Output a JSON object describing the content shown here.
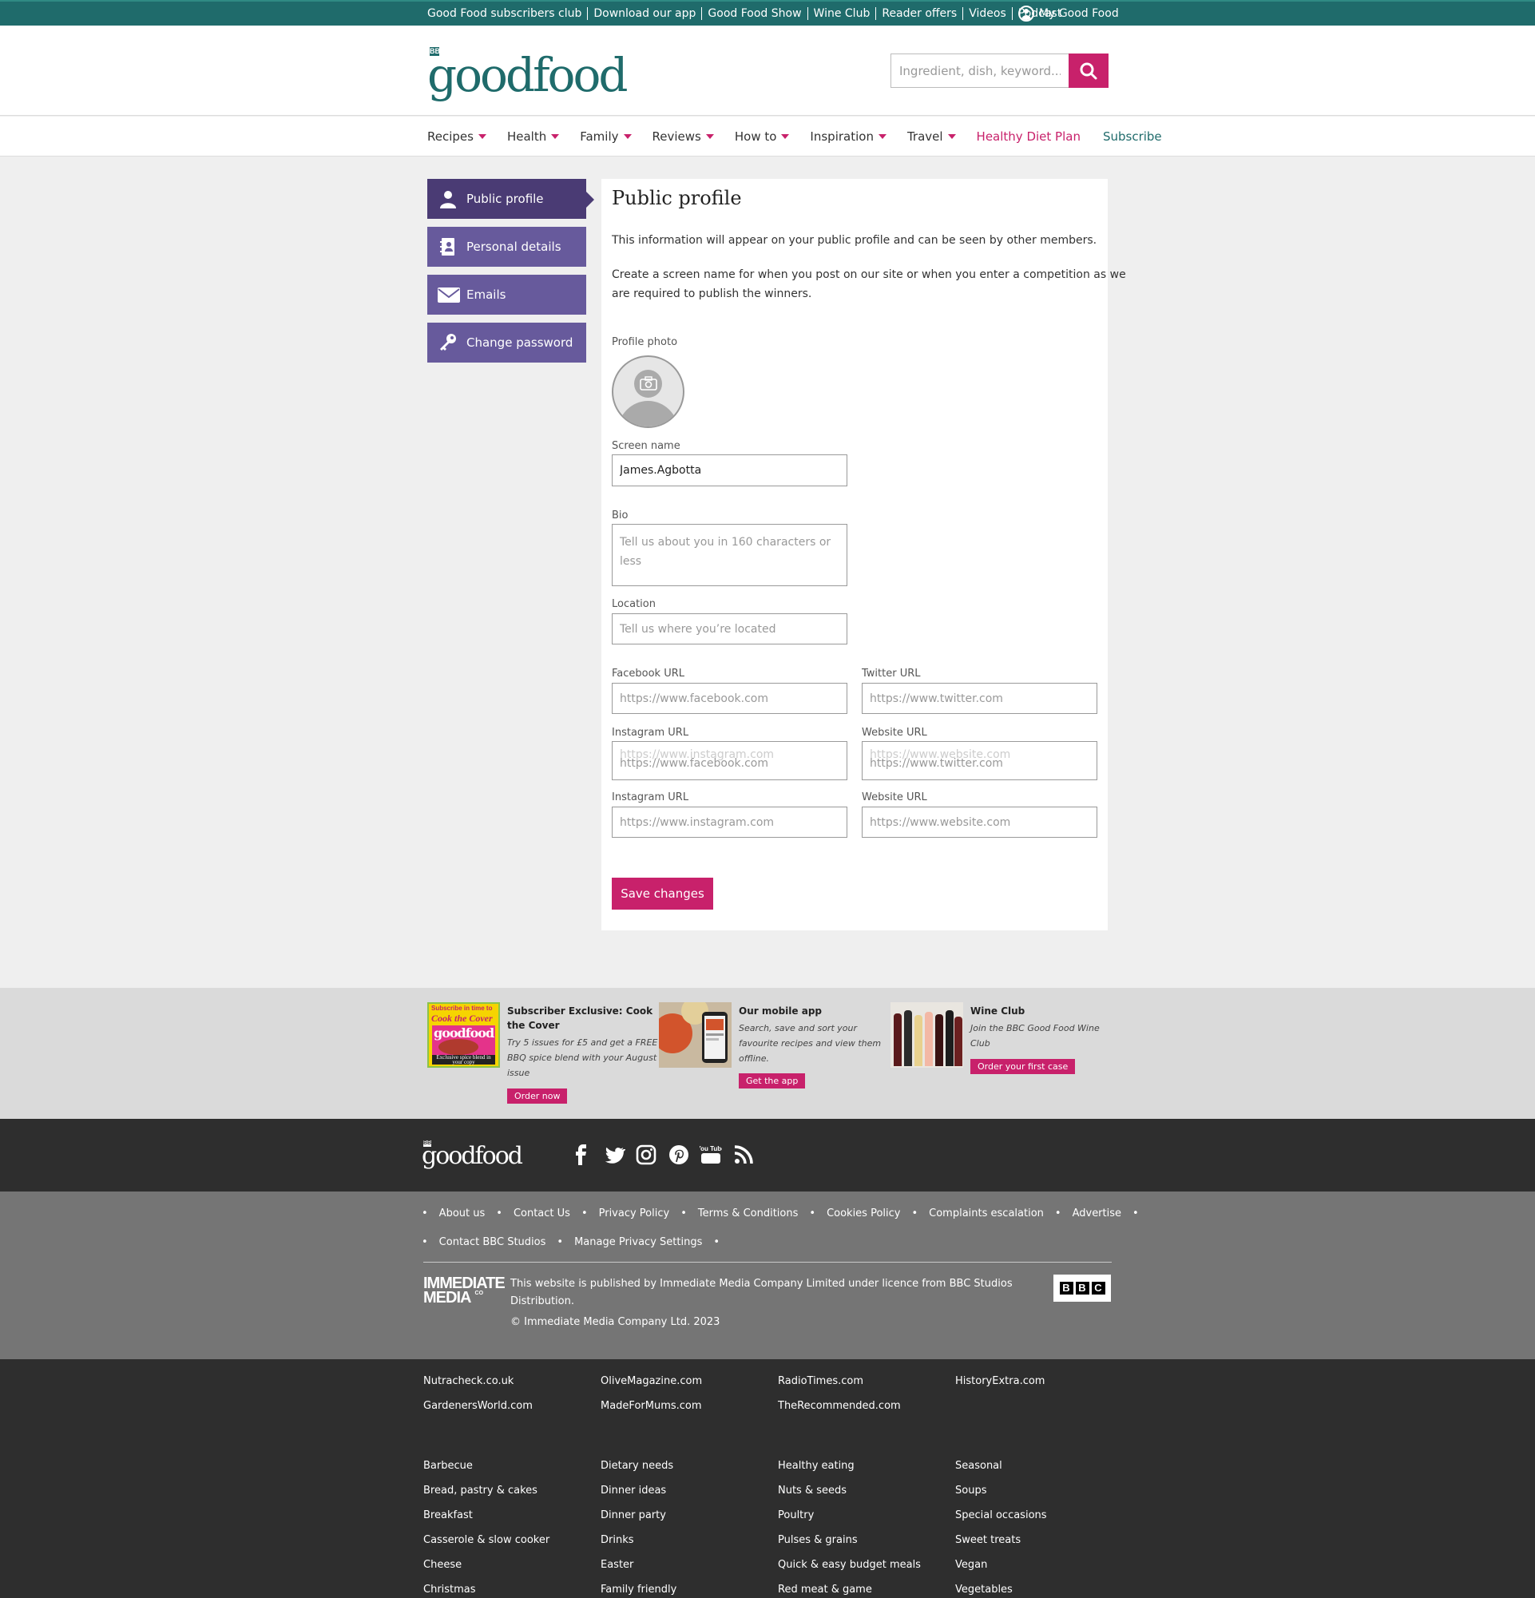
{
  "topbar": {
    "links": [
      "Good Food subscribers club",
      "Download our app",
      "Good Food Show",
      "Wine Club",
      "Reader offers",
      "Videos",
      "Podcast"
    ],
    "account_label": "My Good Food"
  },
  "header": {
    "logo_badge": "BBC",
    "logo_text": "goodfood",
    "search_placeholder": "Ingredient, dish, keyword..."
  },
  "nav": {
    "items": [
      "Recipes",
      "Health",
      "Family",
      "Reviews",
      "How to",
      "Inspiration",
      "Travel"
    ],
    "healthy": "Healthy Diet Plan",
    "subscribe": "Subscribe"
  },
  "sidebar": {
    "items": [
      {
        "label": "Public profile",
        "icon": "person-icon",
        "active": true
      },
      {
        "label": "Personal details",
        "icon": "contact-card-icon"
      },
      {
        "label": "Emails",
        "icon": "envelope-icon"
      },
      {
        "label": "Change password",
        "icon": "key-icon"
      }
    ]
  },
  "profile": {
    "title": "Public profile",
    "intro": "This information will appear on your public profile and can be seen by other members.",
    "intro2_line1": "Create a screen name for when you post on our site or when you enter a competition as we",
    "intro2_line2": "are required to publish the winners.",
    "photo_label": "Profile photo",
    "screen_name_label": "Screen name",
    "screen_name_value": "James.Agbotta",
    "bio_label": "Bio",
    "bio_placeholder": "Tell us about you in 160 characters or less",
    "location_label": "Location",
    "location_placeholder": "Tell us where you’re located",
    "facebook_label": "Facebook URL",
    "facebook_placeholder": "https://www.facebook.com",
    "twitter_label": "Twitter URL",
    "twitter_placeholder": "https://www.twitter.com",
    "instagram_label": "Instagram URL",
    "instagram_placeholder": "https://www.instagram.com",
    "website_label": "Website URL",
    "website_placeholder": "https://www.website.com",
    "overlay_left_bg": "https://www.instagram.com",
    "overlay_left_fg": "https://www.facebook.com",
    "overlay_right_bg": "https://www.website.com",
    "overlay_right_fg": "https://www.twitter.com",
    "save_label": "Save changes"
  },
  "promo": {
    "items": [
      {
        "title_l1": "Subscriber Exclusive: Cook",
        "title_l2": "the Cover",
        "desc_l1": "Try 5 issues for £5 and get a FREE",
        "desc_l2": "BBQ spice blend with your August",
        "desc_l3": "issue",
        "button": "Order now",
        "cover_top": "Subscribe in time to",
        "cover_title": "Cook the Cover",
        "cover_logo": "goodfood",
        "cover_bottom": "Exclusive spice blend in your copy"
      },
      {
        "title_l1": "Our mobile app",
        "desc_l1": "Search, save and sort your",
        "desc_l2": "favourite recipes and view them",
        "desc_l3": "offline.",
        "button": "Get the app"
      },
      {
        "title_l1": "Wine Club",
        "desc_l1": "Join the BBC Good Food Wine",
        "desc_l2": "Club",
        "button": "Order your first case"
      }
    ]
  },
  "footer": {
    "logo_badge": "BBC",
    "logo_text": "goodfood",
    "social": [
      "facebook-icon",
      "twitter-icon",
      "instagram-icon",
      "pinterest-icon",
      "youtube-icon",
      "rss-icon"
    ],
    "youtube_text": "You Tube",
    "links_row1": [
      "About us",
      "Contact Us",
      "Privacy Policy",
      "Terms & Conditions",
      "Cookies Policy",
      "Complaints escalation",
      "Advertise"
    ],
    "links_row2": [
      "Contact BBC Studios",
      "Manage Privacy Settings"
    ],
    "immediate_l1": "IMMEDIATE",
    "immediate_l2": "MEDIA",
    "immediate_co": "CO",
    "publisher_l1": "This website is published by Immediate Media Company Limited under licence from BBC Studios",
    "publisher_l2": "Distribution.",
    "copyright": "© Immediate Media Company Ltd. 2023",
    "bbc_badge": [
      "B",
      "B",
      "C"
    ],
    "sites": [
      [
        "Nutracheck.co.uk",
        "GardenersWorld.com"
      ],
      [
        "OliveMagazine.com",
        "MadeForMums.com"
      ],
      [
        "RadioTimes.com",
        "TheRecommended.com"
      ],
      [
        "HistoryExtra.com"
      ]
    ],
    "categories": [
      [
        "Barbecue",
        "Bread, pastry & cakes",
        "Breakfast",
        "Casserole & slow cooker",
        "Cheese",
        "Christmas"
      ],
      [
        "Dietary needs",
        "Dinner ideas",
        "Dinner party",
        "Drinks",
        "Easter",
        "Family friendly"
      ],
      [
        "Healthy eating",
        "Nuts & seeds",
        "Poultry",
        "Pulses & grains",
        "Quick & easy budget meals",
        "Red meat & game"
      ],
      [
        "Seasonal",
        "Soups",
        "Special occasions",
        "Sweet treats",
        "Vegan",
        "Vegetables"
      ]
    ]
  }
}
